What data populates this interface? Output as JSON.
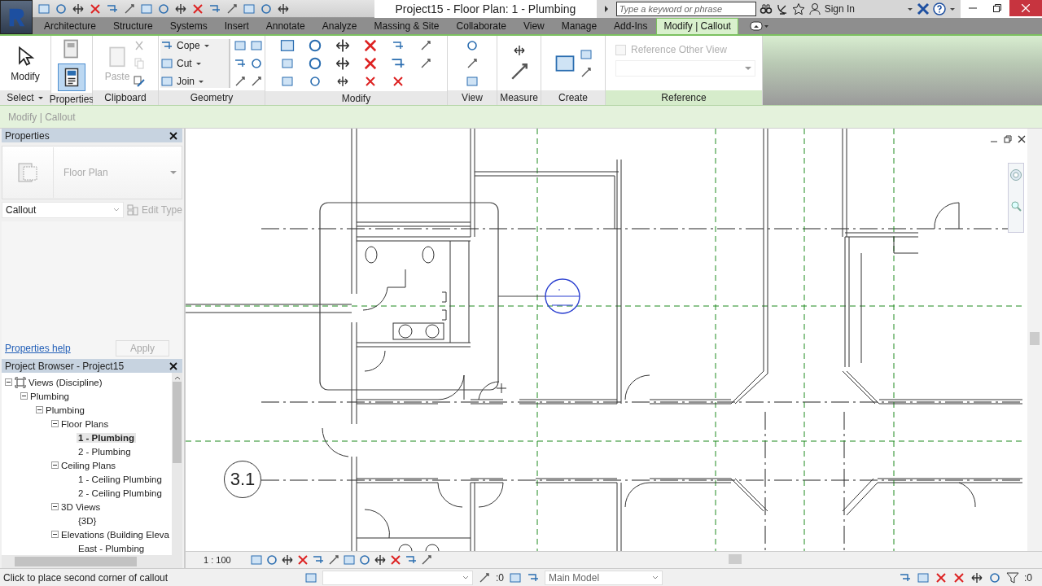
{
  "window": {
    "title": "Project15 - Floor Plan: 1 - Plumbing"
  },
  "search": {
    "placeholder": "Type a keyword or phrase"
  },
  "sign_in": "Sign In",
  "ribbon_tabs": [
    {
      "label": "Architecture",
      "selected": false
    },
    {
      "label": "Structure",
      "selected": false
    },
    {
      "label": "Systems",
      "selected": false
    },
    {
      "label": "Insert",
      "selected": false
    },
    {
      "label": "Annotate",
      "selected": false
    },
    {
      "label": "Analyze",
      "selected": false
    },
    {
      "label": "Massing & Site",
      "selected": false
    },
    {
      "label": "Collaborate",
      "selected": false
    },
    {
      "label": "View",
      "selected": false
    },
    {
      "label": "Manage",
      "selected": false
    },
    {
      "label": "Add-Ins",
      "selected": false
    },
    {
      "label": "Modify | Callout",
      "selected": true
    }
  ],
  "ribbon": {
    "panels": [
      {
        "title": "Select"
      },
      {
        "title": "Properties"
      },
      {
        "title": "Clipboard"
      },
      {
        "title": "Geometry"
      },
      {
        "title": "Modify"
      },
      {
        "title": "View"
      },
      {
        "title": "Measure"
      },
      {
        "title": "Create"
      },
      {
        "title": "Reference"
      }
    ],
    "modify_label": "Modify",
    "properties_button": {
      "selected": true
    },
    "paste": {
      "label": "Paste",
      "disabled": true
    },
    "geometry_tools": [
      {
        "label": "Cope"
      },
      {
        "label": "Cut"
      },
      {
        "label": "Join"
      }
    ],
    "reference_other_view": {
      "label": "Reference Other View",
      "checked": false,
      "disabled": true
    }
  },
  "options_bar": {
    "label": "Modify | Callout"
  },
  "properties": {
    "title": "Properties",
    "type_name": "Floor Plan",
    "instance_filter": "Callout",
    "edit_type": "Edit Type",
    "help_link": "Properties help",
    "apply": "Apply"
  },
  "project_browser": {
    "title": "Project Browser - Project15",
    "tree": [
      {
        "label": "Views (Discipline)",
        "expanded": true,
        "children": [
          {
            "label": "Plumbing",
            "expanded": true,
            "children": [
              {
                "label": "Plumbing",
                "expanded": true,
                "children": [
                  {
                    "label": "Floor Plans",
                    "expanded": true,
                    "children": [
                      {
                        "label": "1 - Plumbing",
                        "selected": true
                      },
                      {
                        "label": "2 - Plumbing",
                        "selected": false
                      }
                    ]
                  },
                  {
                    "label": "Ceiling Plans",
                    "expanded": true,
                    "children": [
                      {
                        "label": "1 - Ceiling Plumbing",
                        "selected": false
                      },
                      {
                        "label": "2 - Ceiling Plumbing",
                        "selected": false
                      }
                    ]
                  },
                  {
                    "label": "3D Views",
                    "expanded": true,
                    "children": [
                      {
                        "label": "{3D}",
                        "selected": false
                      }
                    ]
                  },
                  {
                    "label": "Elevations (Building Eleva",
                    "expanded": true,
                    "children": [
                      {
                        "label": "East - Plumbing",
                        "selected": false
                      }
                    ]
                  }
                ]
              }
            ]
          }
        ]
      }
    ]
  },
  "view": {
    "scale": "1 : 100",
    "grid_bubble": "3.1"
  },
  "status_bar": {
    "message": "Click to place second corner of callout",
    "workset_count": ":0",
    "model": "Main Model",
    "filter_count": ":0"
  }
}
